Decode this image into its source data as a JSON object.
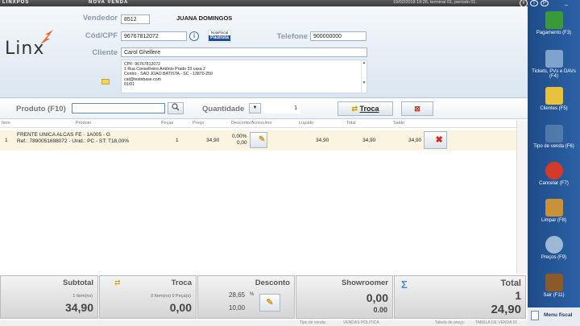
{
  "titlebar": {
    "logo": "LINXPOS",
    "title": "NOVA VENDA",
    "status": "19/02/2018 19:26, terminal 01, período 01."
  },
  "brand": "Linx",
  "header": {
    "vendedor_label": "Vendedor",
    "vendedor_code": "8512",
    "vendedor_name": "JUANA DOMINGOS",
    "cpf_label": "Cód/CPF",
    "cpf_value": "96767812072",
    "telefone_label": "Telefone",
    "telefone_value": "900000000",
    "cliente_label": "Cliente",
    "cliente_value": "Carol Ghellere",
    "nota_paulista": [
      "Nota",
      "Fiscal",
      "Paulista"
    ],
    "address_lines": [
      "CPF: 96767812072",
      "1 Rua Conselheiro Antônio Prado 33 casa 2",
      "Centro - SAO JOAO BATISTA - SC - 13870-250",
      "cat@testebase.com",
      "01/01"
    ]
  },
  "produto": {
    "label": "Produto (F10)",
    "value": "",
    "quantidade_label": "Quantidade",
    "quantidade_value": "1",
    "troca_label": "Troca"
  },
  "grid": {
    "columns": [
      "Item",
      "Produto",
      "Peças",
      "Preço",
      "Desconto/Acréscimo",
      "Líquido",
      "Total",
      "Saldo"
    ],
    "rows": [
      {
        "item": "1",
        "produto_line1": "FRENTE UNICA ALCAS FE - 1A005 - G",
        "produto_line2": "Ref.: 7890051698072 - Unid.: PC - ST: T18,00%",
        "pecas": "1",
        "preco": "34,90",
        "desc_pct": "0,00%",
        "desc_val": "0,00",
        "liquido": "34,90",
        "total": "34,90",
        "saldo": "34,90"
      }
    ]
  },
  "totals": {
    "subtotal": {
      "label": "Subtotal",
      "items": "1 Item(ns)",
      "value": "34,90"
    },
    "troca": {
      "label": "Troca",
      "items": "0 Item(ns) 0 Peça(s)",
      "value": "0,00"
    },
    "desconto": {
      "label": "Desconto",
      "pct": "28,65",
      "pct_unit": "%",
      "value": "10,00"
    },
    "showroomer": {
      "label": "Showroomer",
      "value1": "0,00",
      "value2": "0.00"
    },
    "total": {
      "label": "Total",
      "count": "1",
      "value": "24,90"
    }
  },
  "footer": {
    "tipo_label": "Tipo de venda:",
    "tipo_value": "VENDAS POLITICA",
    "tabela_label": "Tabela de preço:",
    "tabela_value": "TABELA DE VENDA 01"
  },
  "sidebar": {
    "items": [
      {
        "label": "Pagamento (F3)",
        "icon": "cash-register-icon",
        "color": "#3a9a3a"
      },
      {
        "label": "Tickets, PVs e DAVs (F4)",
        "icon": "tickets-icon",
        "color": "#7fa3cc"
      },
      {
        "label": "Clientes (F5)",
        "icon": "folder-icon",
        "color": "#e8c13d"
      },
      {
        "label": "Tipo de venda (F6)",
        "icon": "sale-type-icon",
        "color": "#6d8fba"
      },
      {
        "label": "Cancelar (F7)",
        "icon": "cancel-icon",
        "color": "#d43a2a"
      },
      {
        "label": "Limpar (F8)",
        "icon": "broom-icon",
        "color": "#c8913a"
      },
      {
        "label": "Preços (F9)",
        "icon": "price-search-icon",
        "color": "#9bb8d6"
      },
      {
        "label": "Sair (F11)",
        "icon": "exit-door-icon",
        "color": "#8a5a2a"
      }
    ],
    "menu_fiscal": "Menu fiscal"
  }
}
